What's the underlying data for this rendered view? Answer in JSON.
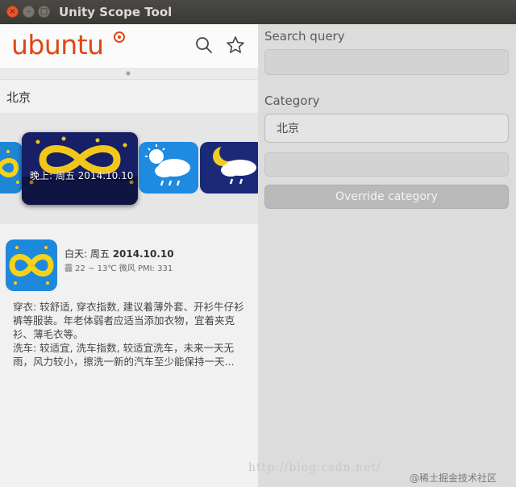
{
  "window": {
    "title": "Unity Scope Tool",
    "close_glyph": "×",
    "min_glyph": "–",
    "max_glyph": "□"
  },
  "header": {
    "logo_text": "ubuntu",
    "search_icon": "search-icon",
    "favorite_icon": "star-icon",
    "brand_color": "#dd4814"
  },
  "scope": {
    "category_label": "北京",
    "carousel": {
      "focused_label": "晚上: 周五 2014.10.10"
    },
    "detail": {
      "title_prefix": "白天: 周五 ",
      "title_date": "2014.10.10",
      "subtitle": "霾 22 ~ 13℃ 微风 PMI: 331",
      "body": "穿衣: 较舒适, 穿衣指数, 建议着薄外套、开衫牛仔衫裤等服装。年老体弱者应适当添加衣物，宜着夹克衫、薄毛衣等。\n洗车: 较适宜, 洗车指数, 较适宜洗车，未来一天无雨，风力较小，擦洗一新的汽车至少能保持一天..."
    }
  },
  "controls": {
    "search_label": "Search query",
    "search_value": "",
    "category_label": "Category",
    "category_value": "北京",
    "extra_value": "",
    "override_button": "Override category"
  },
  "watermark": {
    "url": "http://blog.csdn.net/",
    "site": "@稀土掘金技术社区"
  }
}
